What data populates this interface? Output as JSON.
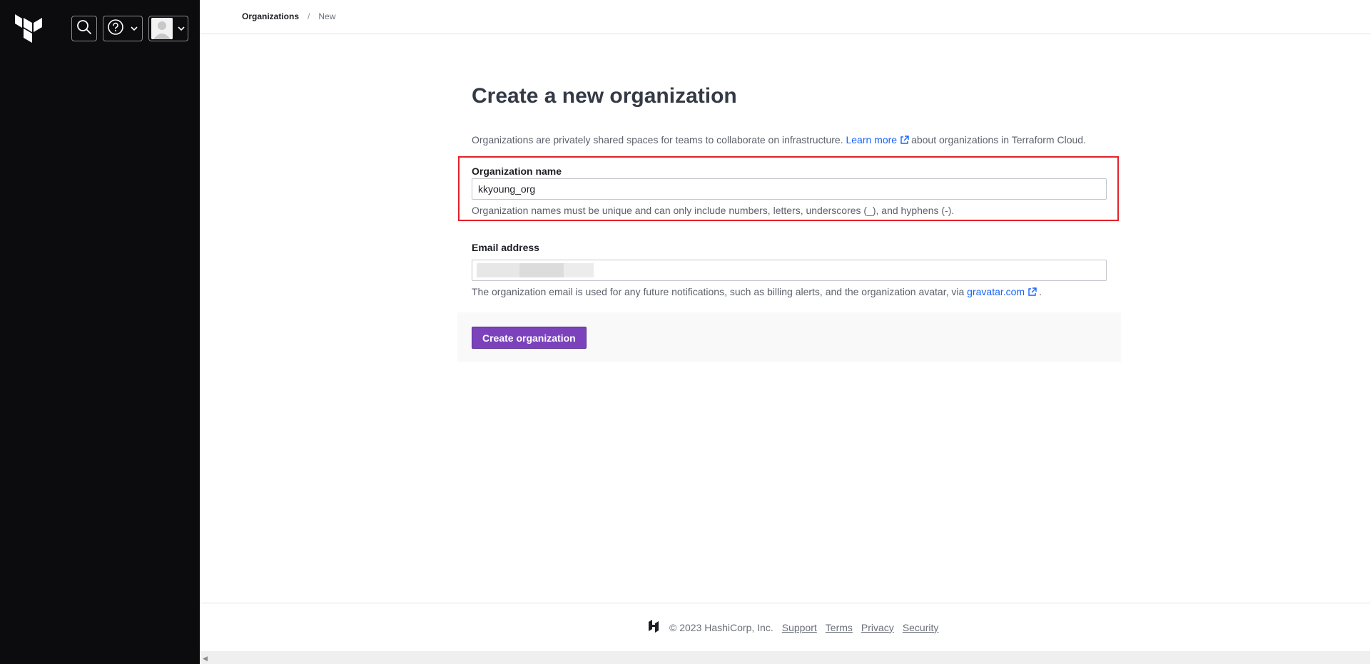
{
  "sidebar": {
    "logo": "terraform-logo",
    "search_icon": "search-icon",
    "help_icon": "help-icon",
    "user_icon": "user-avatar"
  },
  "breadcrumb": {
    "organizations": "Organizations",
    "separator": "/",
    "current": "New"
  },
  "page": {
    "title": "Create a new organization",
    "intro_prefix": "Organizations are privately shared spaces for teams to collaborate on infrastructure.",
    "learn_more": "Learn more",
    "intro_suffix": "about organizations in Terraform Cloud."
  },
  "form": {
    "org_name_label": "Organization name",
    "org_name_value": "kkyoung_org",
    "org_name_help": "Organization names must be unique and can only include numbers, letters, underscores (_), and hyphens (-).",
    "email_label": "Email address",
    "email_help_prefix": "The organization email is used for any future notifications, such as billing alerts, and the organization avatar, via",
    "gravatar_link": "gravatar.com",
    "email_help_suffix": ".",
    "submit_label": "Create organization"
  },
  "footer": {
    "copyright": "© 2023 HashiCorp, Inc.",
    "links": [
      "Support",
      "Terms",
      "Privacy",
      "Security"
    ]
  },
  "colors": {
    "sidebar_bg": "#0c0c0e",
    "link": "#1563ff",
    "primary": "#7b42bc",
    "highlight": "#e32229"
  }
}
